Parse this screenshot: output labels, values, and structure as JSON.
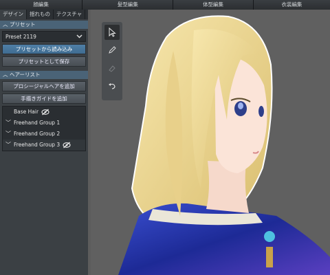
{
  "top_tabs": [
    "顔編集",
    "髪型編集",
    "体型編集",
    "衣装編集"
  ],
  "sub_tabs": [
    "デザイン",
    "揺れもの",
    "テクスチャ"
  ],
  "preset": {
    "section_title": "プリセット",
    "selected": "Preset 2119",
    "load_label": "プリセットから読み込み",
    "save_label": "プリセットとして保存"
  },
  "hair_list": {
    "section_title": "ヘアーリスト",
    "add_procedural_label": "プロシージャルヘアを追加",
    "add_handdrawn_label": "手描きガイドを追加",
    "items": [
      {
        "label": "Base Hair",
        "expandable": false,
        "hidden": true
      },
      {
        "label": "Freehand Group 1",
        "expandable": true,
        "hidden": false
      },
      {
        "label": "Freehand Group 2",
        "expandable": true,
        "hidden": false
      },
      {
        "label": "Freehand Group 3",
        "expandable": true,
        "hidden": true
      }
    ]
  },
  "tools": [
    {
      "name": "select-tool",
      "active": true
    },
    {
      "name": "pen-tool",
      "active": false
    },
    {
      "name": "eraser-tool",
      "active": false
    },
    {
      "name": "undo-tool",
      "active": false
    }
  ],
  "colors": {
    "accent": "#4f7fa6",
    "section_header": "#4a6377",
    "hair": "#f0dc96",
    "dress": "#2a3fb0"
  }
}
